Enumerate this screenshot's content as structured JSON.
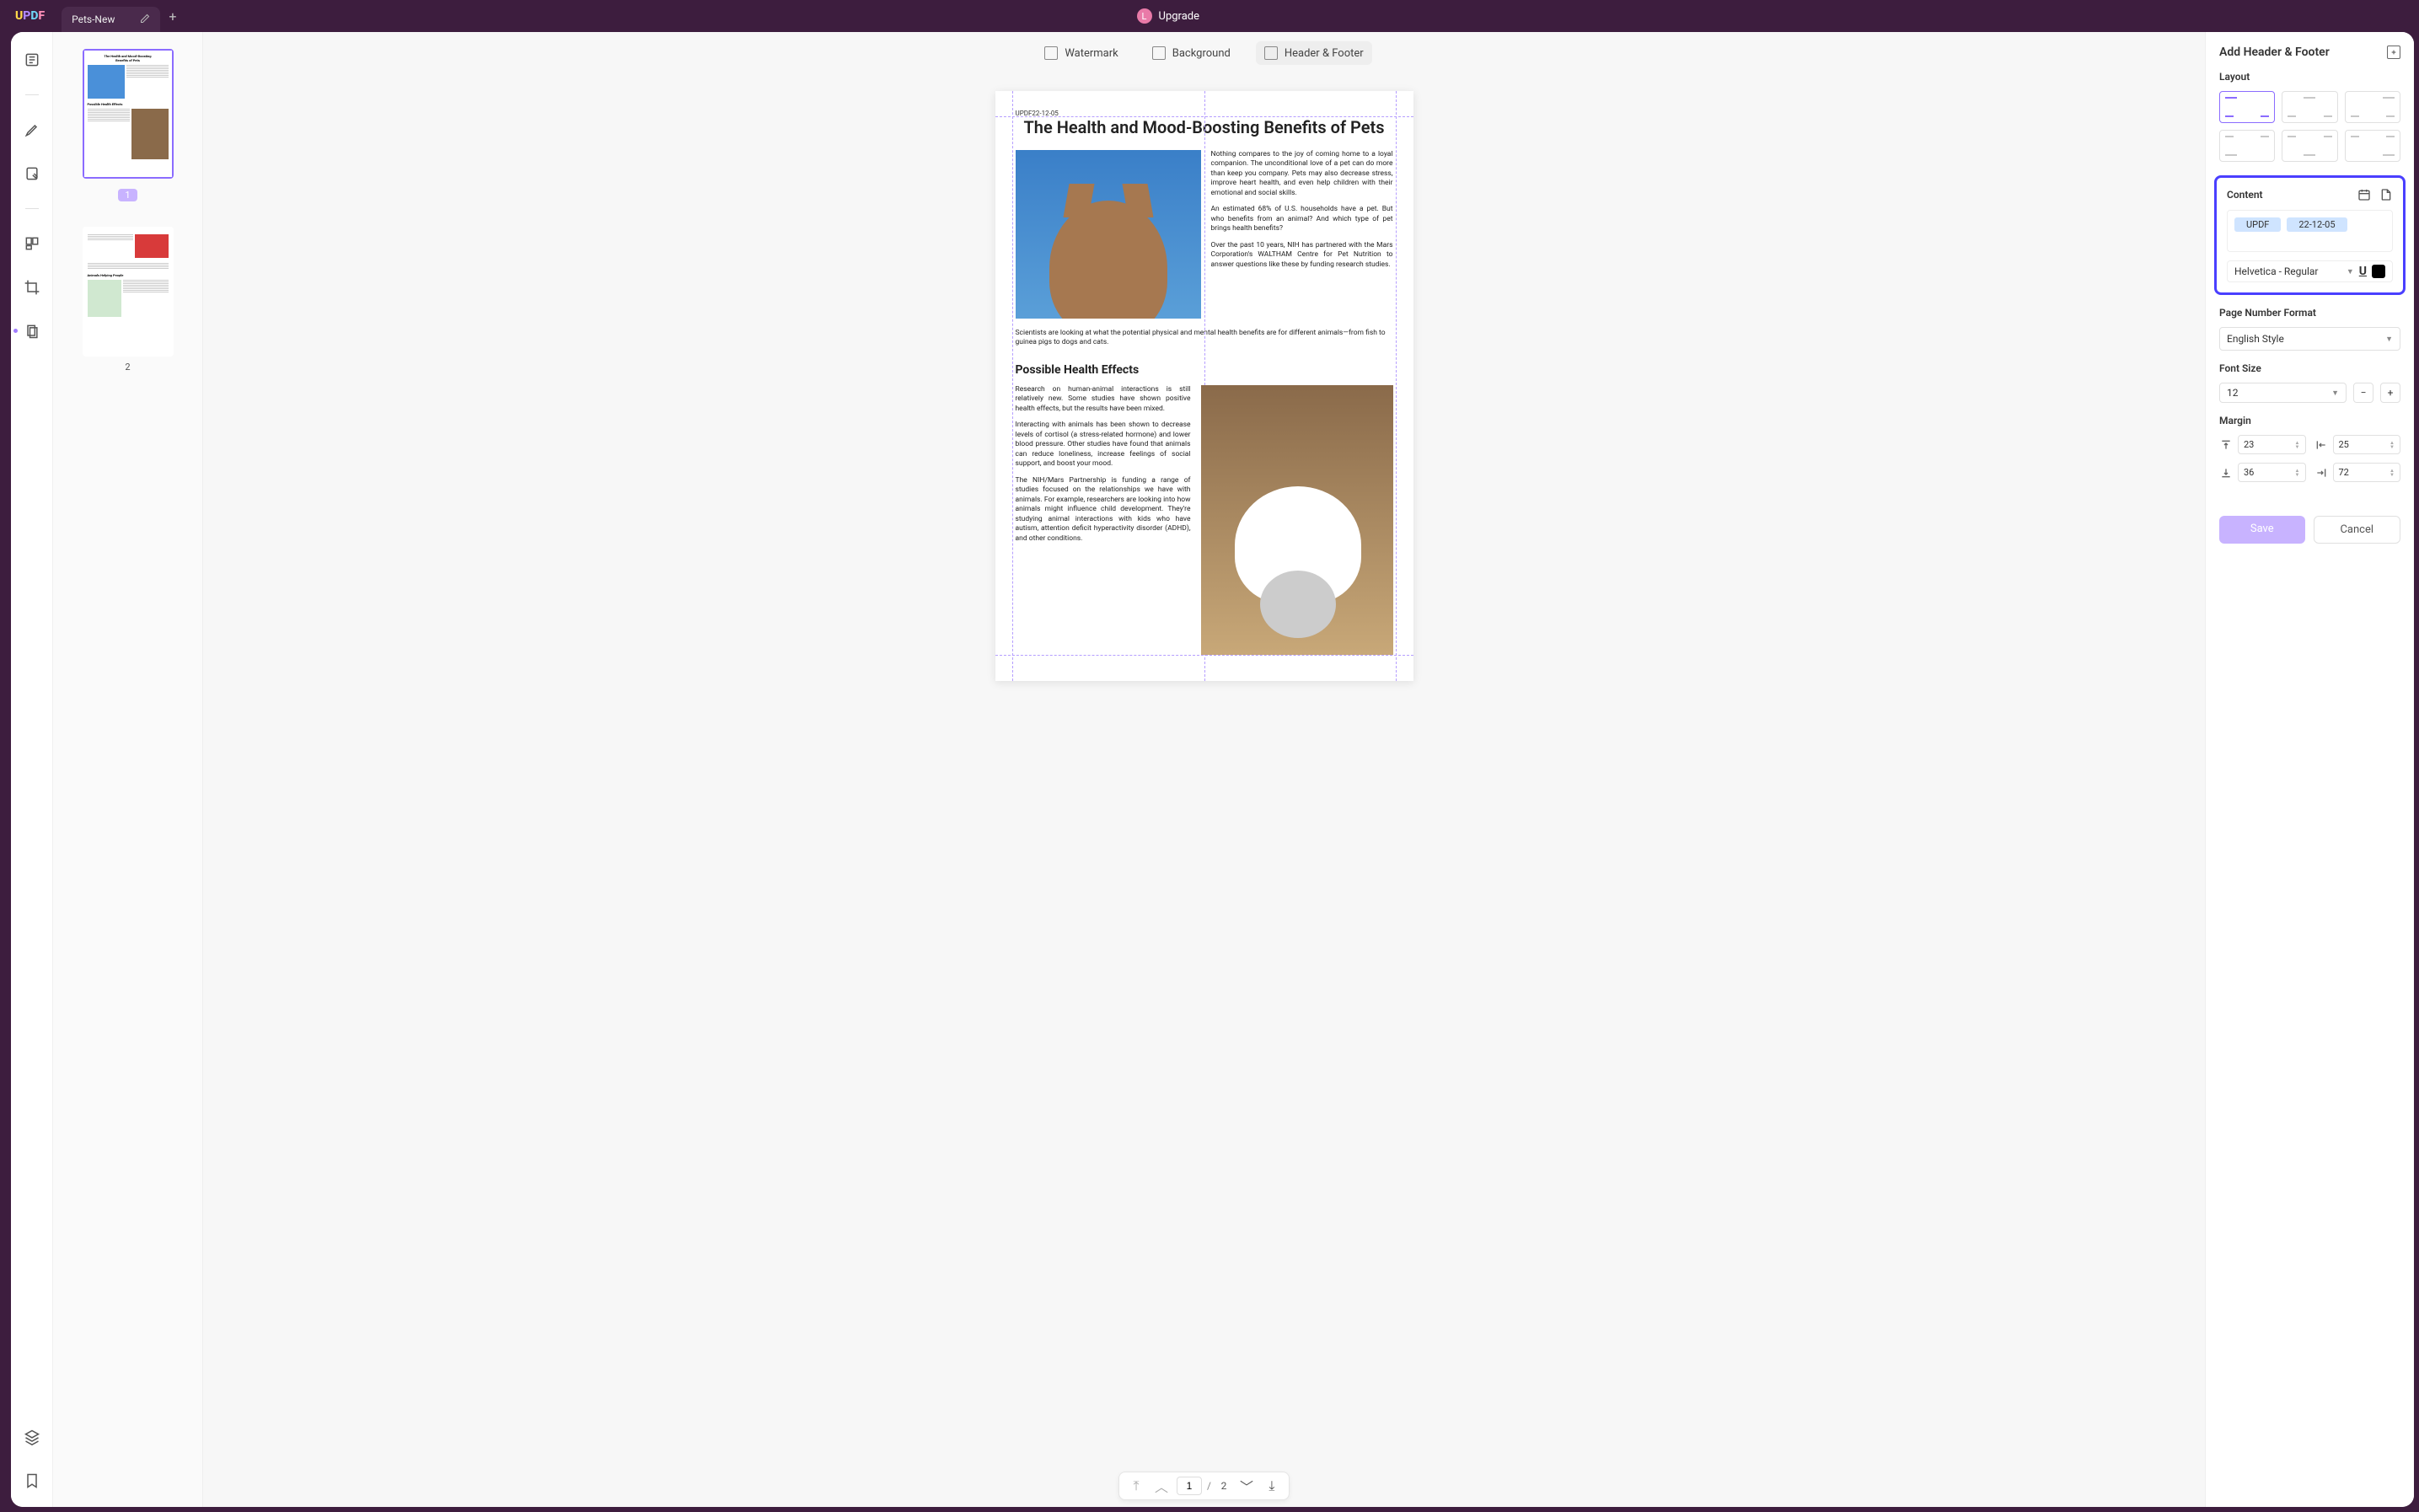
{
  "app": {
    "logo_u": "U",
    "logo_p": "P",
    "logo_d": "D",
    "logo_f": "F"
  },
  "tab": {
    "title": "Pets-New"
  },
  "upgrade": {
    "avatar": "L",
    "label": "Upgrade"
  },
  "topTabs": {
    "watermark": "Watermark",
    "background": "Background",
    "headerFooter": "Header & Footer"
  },
  "thumbs": {
    "p1": "1",
    "p2": "2"
  },
  "page": {
    "header": "UPDF22-12-05",
    "title": "The Health and Mood-Boosting Benefits of Pets",
    "para1": "Nothing compares to the joy of coming home to a loyal companion. The unconditional love of a pet can do more than keep you company. Pets may also decrease stress, improve heart health, and even help children with their emotional and social skills.",
    "para2": "An estimated 68% of U.S. households have a pet. But who benefits from an animal? And which type of pet brings health benefits?",
    "para3": "Over the past 10 years, NIH has partnered with the Mars Corporation's WALTHAM Centre for Pet Nutrition to answer questions like these by funding research studies.",
    "para4": "Scientists are looking at what the potential physical and mental health benefits are for different animals—from fish to guinea pigs to dogs and cats.",
    "section": "Possible Health Effects",
    "para5": "Research on human-animal interactions is still relatively new. Some studies have shown positive health effects, but the results have been mixed.",
    "para6": "Interacting with animals has been shown to decrease levels of cortisol (a stress-related hormone) and lower blood pressure. Other studies have found that animals can reduce loneliness, increase feelings of social support, and boost your mood.",
    "para7": "The NIH/Mars Partnership is funding a range of studies focused on the relationships we have with animals. For example, researchers are looking into how animals might influence child development. They're studying animal interactions with kids who have autism, attention deficit hyperactivity disorder (ADHD), and other conditions."
  },
  "pager": {
    "current": "1",
    "total": "2"
  },
  "panel": {
    "title": "Add Header & Footer",
    "layout": "Layout",
    "content": "Content",
    "chip1": "UPDF",
    "chip2": "22-12-05",
    "font": "Helvetica - Regular",
    "pageNumFormat": "Page Number Format",
    "pageNumStyle": "English Style",
    "fontSize": "Font Size",
    "fontSizeVal": "12",
    "margin": "Margin",
    "m_top": "23",
    "m_left": "25",
    "m_bottom": "36",
    "m_right": "72",
    "save": "Save",
    "cancel": "Cancel"
  }
}
